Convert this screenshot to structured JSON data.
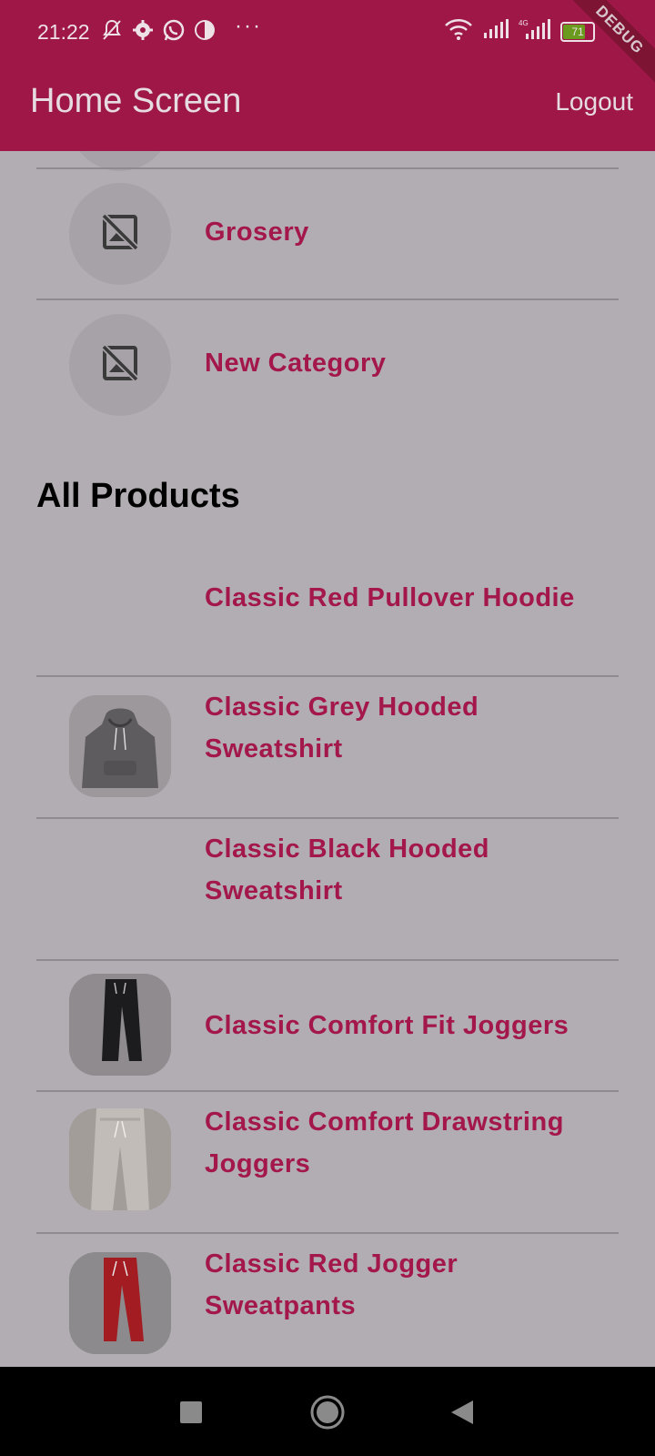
{
  "status_bar": {
    "time": "21:22",
    "battery": "71",
    "icons": [
      "mute-bell-icon",
      "gear-icon",
      "whatsapp-icon",
      "app-icon",
      "more-icon",
      "wifi-icon",
      "signal-icon",
      "signal-4g-icon",
      "battery-icon"
    ]
  },
  "app_bar": {
    "title": "Home Screen",
    "logout": "Logout",
    "debug_banner": "DEBUG"
  },
  "categories": [
    {
      "name": "Grosery",
      "icon": "broken-image-icon"
    },
    {
      "name": "New Category",
      "icon": "broken-image-icon"
    }
  ],
  "section_title": "All Products",
  "products": [
    {
      "name": "Classic Red Pullover Hoodie",
      "image": "none"
    },
    {
      "name": "Classic Grey Hooded Sweatshirt",
      "image": "grey-hoodie"
    },
    {
      "name": "Classic Black Hooded Sweatshirt",
      "image": "none"
    },
    {
      "name": "Classic Comfort Fit Joggers",
      "image": "black-joggers"
    },
    {
      "name": "Classic Comfort Drawstring Joggers",
      "image": "grey-joggers"
    },
    {
      "name": "Classic Red Jogger Sweatpants",
      "image": "red-joggers"
    }
  ],
  "colors": {
    "app_bar": "#9e1747",
    "accent_text": "#a3174b",
    "scrim_background": "#b2adb2"
  }
}
